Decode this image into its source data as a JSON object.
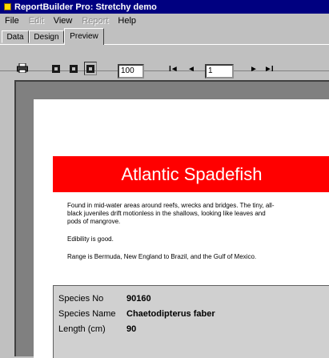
{
  "window": {
    "title": "ReportBuilder Pro: Stretchy demo"
  },
  "menu": {
    "items": [
      {
        "label": "File",
        "enabled": true
      },
      {
        "label": "Edit",
        "enabled": false
      },
      {
        "label": "View",
        "enabled": true
      },
      {
        "label": "Report",
        "enabled": false
      },
      {
        "label": "Help",
        "enabled": true
      }
    ]
  },
  "tabs": [
    {
      "label": "Data",
      "active": false
    },
    {
      "label": "Design",
      "active": false
    },
    {
      "label": "Preview",
      "active": true
    }
  ],
  "toolbar": {
    "print_icon": "printer-icon",
    "view_icons": [
      "whole-page-icon",
      "page-width-icon",
      "actual-size-icon"
    ],
    "zoom_value": "100 %",
    "first_page_glyph": "I◄",
    "prev_page_glyph": "◄",
    "page_number": "1",
    "next_page_glyph": "►",
    "last_page_glyph": "►I"
  },
  "report": {
    "title": "Atlantic Spadefish",
    "title_bg": "#ff0000",
    "description": [
      "Found in mid-water areas around reefs, wrecks and bridges. The tiny, all-black juveniles drift motionless in the shallows, looking like leaves and pods of mangrove.",
      "Edibility is good.",
      "Range is Bermuda, New England to Brazil, and the Gulf of Mexico."
    ],
    "fields": [
      {
        "label": "Species No",
        "value": "90160"
      },
      {
        "label": "Species Name",
        "value": "Chaetodipterus faber"
      },
      {
        "label": "Length (cm)",
        "value": "90"
      }
    ]
  }
}
